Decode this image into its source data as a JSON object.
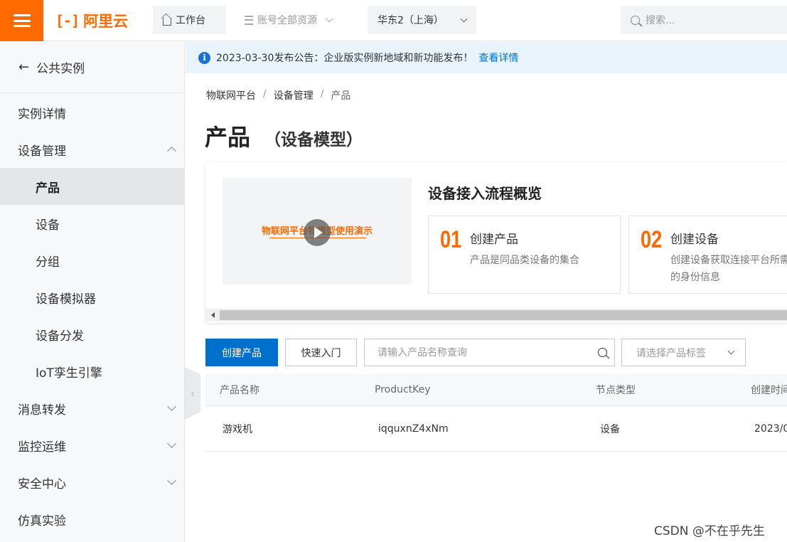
{
  "topbar": {
    "logo_mark": "[-]",
    "logo_text": "阿里云",
    "workbench": "工作台",
    "resources": "账号全部资源",
    "region": "华东2（上海）",
    "search_placeholder": "搜索..."
  },
  "sidebar": {
    "back_label": "公共实例",
    "items": [
      {
        "label": "实例详情"
      },
      {
        "label": "设备管理"
      },
      {
        "label": "产品"
      },
      {
        "label": "设备"
      },
      {
        "label": "分组"
      },
      {
        "label": "设备模拟器"
      },
      {
        "label": "设备分发"
      },
      {
        "label": "IoT孪生引擎"
      },
      {
        "label": "消息转发"
      },
      {
        "label": "监控运维"
      },
      {
        "label": "安全中心"
      },
      {
        "label": "仿真实验"
      }
    ],
    "collapse_glyph": "‹"
  },
  "notice": {
    "text": "2023-03-30发布公告：企业版实例新地域和新功能发布！",
    "link": "查看详情"
  },
  "breadcrumb": [
    "物联网平台",
    "设备管理",
    "产品"
  ],
  "page": {
    "title": "产品",
    "subtitle": "（设备模型）"
  },
  "flow": {
    "video_title": "物联网平台物模型使用演示",
    "title": "设备接入流程概览",
    "steps": [
      {
        "num": "01",
        "name": "创建产品",
        "desc": "产品是同品类设备的集合"
      },
      {
        "num": "02",
        "name": "创建设备",
        "desc": "创建设备获取连接平台所需的身份信息"
      }
    ]
  },
  "toolbar": {
    "create_button": "创建产品",
    "quickstart_button": "快速入门",
    "search_placeholder": "请输入产品名称查询",
    "tag_select_placeholder": "请选择产品标签"
  },
  "table": {
    "columns": [
      "产品名称",
      "ProductKey",
      "节点类型",
      "创建时间"
    ],
    "rows": [
      {
        "name": "游戏机",
        "key": "iqquxnZ4xNm",
        "node_type": "设备",
        "created": "2023/0"
      }
    ]
  },
  "watermark": "CSDN @不在乎先生",
  "colors": {
    "brand": "#ff6a00",
    "primary": "#0070cc"
  }
}
